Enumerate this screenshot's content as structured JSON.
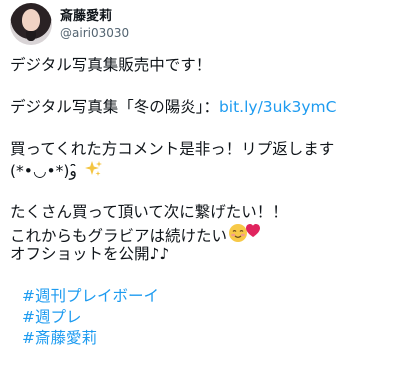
{
  "author": {
    "display_name": "斎藤愛莉",
    "handle": "@airi03030"
  },
  "tweet": {
    "line1": "デジタル写真集販売中です！",
    "line2_text": "デジタル写真集「冬の陽炎」：",
    "line2_link": "bit.ly/3uk3ymC",
    "line3": "買ってくれた方コメント是非っ！リプ返します",
    "line4": "(*•◡•*)ﻭ ̑̑",
    "line5": "たくさん買って頂いて次に繋げたい！！",
    "line6": "これからもグラビアは続けたい",
    "line7": "オフショットを公開♪♪",
    "hashtags": [
      "#週刊プレイボーイ",
      "#週プレ",
      "#斎藤愛莉"
    ]
  },
  "colors": {
    "text": "#0f1419",
    "secondary": "#536471",
    "link": "#1d9bf0"
  },
  "icons": {
    "sparkles": "sparkles-icon",
    "face": "smiling-face-icon",
    "heart": "heart-icon"
  }
}
